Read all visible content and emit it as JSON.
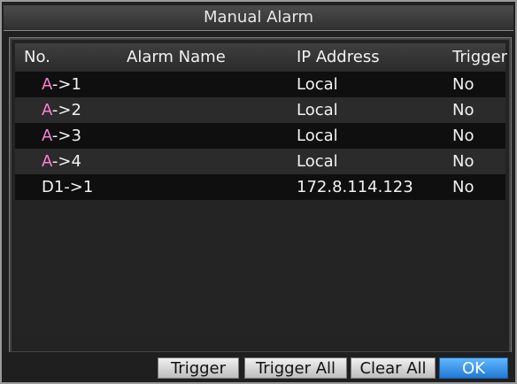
{
  "window": {
    "title": "Manual Alarm"
  },
  "table": {
    "headers": {
      "no": "No.",
      "name": "Alarm Name",
      "ip": "IP Address",
      "trigger": "Trigger"
    },
    "rows": [
      {
        "no_prefix": "A",
        "no_rest": "->1",
        "name": "",
        "ip": "Local",
        "trigger": "No"
      },
      {
        "no_prefix": "A",
        "no_rest": "->2",
        "name": "",
        "ip": "Local",
        "trigger": "No"
      },
      {
        "no_prefix": "A",
        "no_rest": "->3",
        "name": "",
        "ip": "Local",
        "trigger": "No"
      },
      {
        "no_prefix": "A",
        "no_rest": "->4",
        "name": "",
        "ip": "Local",
        "trigger": "No"
      },
      {
        "no_prefix": "D1",
        "no_rest": "->1",
        "name": "",
        "ip": "172.8.114.123",
        "trigger": "No"
      }
    ]
  },
  "buttons": {
    "trigger": "Trigger",
    "trigger_all": "Trigger All",
    "clear_all": "Clear All",
    "ok": "OK"
  }
}
